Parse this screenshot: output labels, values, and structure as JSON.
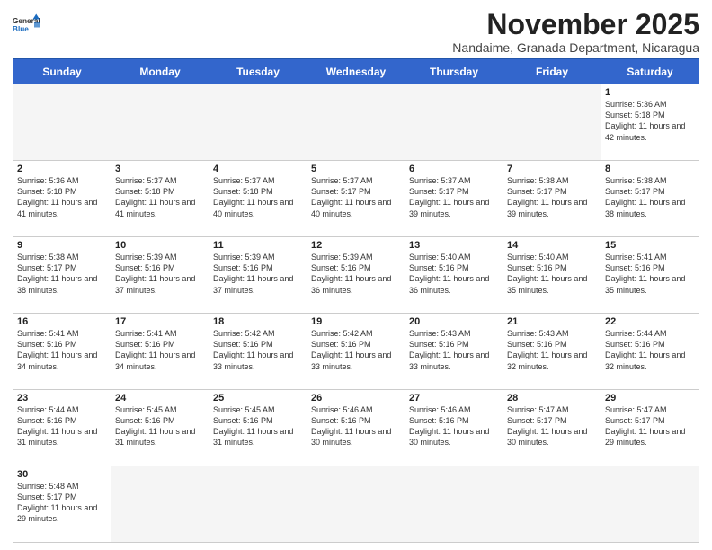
{
  "header": {
    "logo_general": "General",
    "logo_blue": "Blue",
    "month_title": "November 2025",
    "subtitle": "Nandaime, Granada Department, Nicaragua"
  },
  "days_of_week": [
    "Sunday",
    "Monday",
    "Tuesday",
    "Wednesday",
    "Thursday",
    "Friday",
    "Saturday"
  ],
  "weeks": [
    [
      {
        "day": "",
        "info": ""
      },
      {
        "day": "",
        "info": ""
      },
      {
        "day": "",
        "info": ""
      },
      {
        "day": "",
        "info": ""
      },
      {
        "day": "",
        "info": ""
      },
      {
        "day": "",
        "info": ""
      },
      {
        "day": "1",
        "info": "Sunrise: 5:36 AM\nSunset: 5:18 PM\nDaylight: 11 hours\nand 42 minutes."
      }
    ],
    [
      {
        "day": "2",
        "info": "Sunrise: 5:36 AM\nSunset: 5:18 PM\nDaylight: 11 hours\nand 41 minutes."
      },
      {
        "day": "3",
        "info": "Sunrise: 5:37 AM\nSunset: 5:18 PM\nDaylight: 11 hours\nand 41 minutes."
      },
      {
        "day": "4",
        "info": "Sunrise: 5:37 AM\nSunset: 5:18 PM\nDaylight: 11 hours\nand 40 minutes."
      },
      {
        "day": "5",
        "info": "Sunrise: 5:37 AM\nSunset: 5:17 PM\nDaylight: 11 hours\nand 40 minutes."
      },
      {
        "day": "6",
        "info": "Sunrise: 5:37 AM\nSunset: 5:17 PM\nDaylight: 11 hours\nand 39 minutes."
      },
      {
        "day": "7",
        "info": "Sunrise: 5:38 AM\nSunset: 5:17 PM\nDaylight: 11 hours\nand 39 minutes."
      },
      {
        "day": "8",
        "info": "Sunrise: 5:38 AM\nSunset: 5:17 PM\nDaylight: 11 hours\nand 38 minutes."
      }
    ],
    [
      {
        "day": "9",
        "info": "Sunrise: 5:38 AM\nSunset: 5:17 PM\nDaylight: 11 hours\nand 38 minutes."
      },
      {
        "day": "10",
        "info": "Sunrise: 5:39 AM\nSunset: 5:16 PM\nDaylight: 11 hours\nand 37 minutes."
      },
      {
        "day": "11",
        "info": "Sunrise: 5:39 AM\nSunset: 5:16 PM\nDaylight: 11 hours\nand 37 minutes."
      },
      {
        "day": "12",
        "info": "Sunrise: 5:39 AM\nSunset: 5:16 PM\nDaylight: 11 hours\nand 36 minutes."
      },
      {
        "day": "13",
        "info": "Sunrise: 5:40 AM\nSunset: 5:16 PM\nDaylight: 11 hours\nand 36 minutes."
      },
      {
        "day": "14",
        "info": "Sunrise: 5:40 AM\nSunset: 5:16 PM\nDaylight: 11 hours\nand 35 minutes."
      },
      {
        "day": "15",
        "info": "Sunrise: 5:41 AM\nSunset: 5:16 PM\nDaylight: 11 hours\nand 35 minutes."
      }
    ],
    [
      {
        "day": "16",
        "info": "Sunrise: 5:41 AM\nSunset: 5:16 PM\nDaylight: 11 hours\nand 34 minutes."
      },
      {
        "day": "17",
        "info": "Sunrise: 5:41 AM\nSunset: 5:16 PM\nDaylight: 11 hours\nand 34 minutes."
      },
      {
        "day": "18",
        "info": "Sunrise: 5:42 AM\nSunset: 5:16 PM\nDaylight: 11 hours\nand 33 minutes."
      },
      {
        "day": "19",
        "info": "Sunrise: 5:42 AM\nSunset: 5:16 PM\nDaylight: 11 hours\nand 33 minutes."
      },
      {
        "day": "20",
        "info": "Sunrise: 5:43 AM\nSunset: 5:16 PM\nDaylight: 11 hours\nand 33 minutes."
      },
      {
        "day": "21",
        "info": "Sunrise: 5:43 AM\nSunset: 5:16 PM\nDaylight: 11 hours\nand 32 minutes."
      },
      {
        "day": "22",
        "info": "Sunrise: 5:44 AM\nSunset: 5:16 PM\nDaylight: 11 hours\nand 32 minutes."
      }
    ],
    [
      {
        "day": "23",
        "info": "Sunrise: 5:44 AM\nSunset: 5:16 PM\nDaylight: 11 hours\nand 31 minutes."
      },
      {
        "day": "24",
        "info": "Sunrise: 5:45 AM\nSunset: 5:16 PM\nDaylight: 11 hours\nand 31 minutes."
      },
      {
        "day": "25",
        "info": "Sunrise: 5:45 AM\nSunset: 5:16 PM\nDaylight: 11 hours\nand 31 minutes."
      },
      {
        "day": "26",
        "info": "Sunrise: 5:46 AM\nSunset: 5:16 PM\nDaylight: 11 hours\nand 30 minutes."
      },
      {
        "day": "27",
        "info": "Sunrise: 5:46 AM\nSunset: 5:16 PM\nDaylight: 11 hours\nand 30 minutes."
      },
      {
        "day": "28",
        "info": "Sunrise: 5:47 AM\nSunset: 5:17 PM\nDaylight: 11 hours\nand 30 minutes."
      },
      {
        "day": "29",
        "info": "Sunrise: 5:47 AM\nSunset: 5:17 PM\nDaylight: 11 hours\nand 29 minutes."
      }
    ],
    [
      {
        "day": "30",
        "info": "Sunrise: 5:48 AM\nSunset: 5:17 PM\nDaylight: 11 hours\nand 29 minutes."
      },
      {
        "day": "",
        "info": ""
      },
      {
        "day": "",
        "info": ""
      },
      {
        "day": "",
        "info": ""
      },
      {
        "day": "",
        "info": ""
      },
      {
        "day": "",
        "info": ""
      },
      {
        "day": "",
        "info": ""
      }
    ]
  ]
}
